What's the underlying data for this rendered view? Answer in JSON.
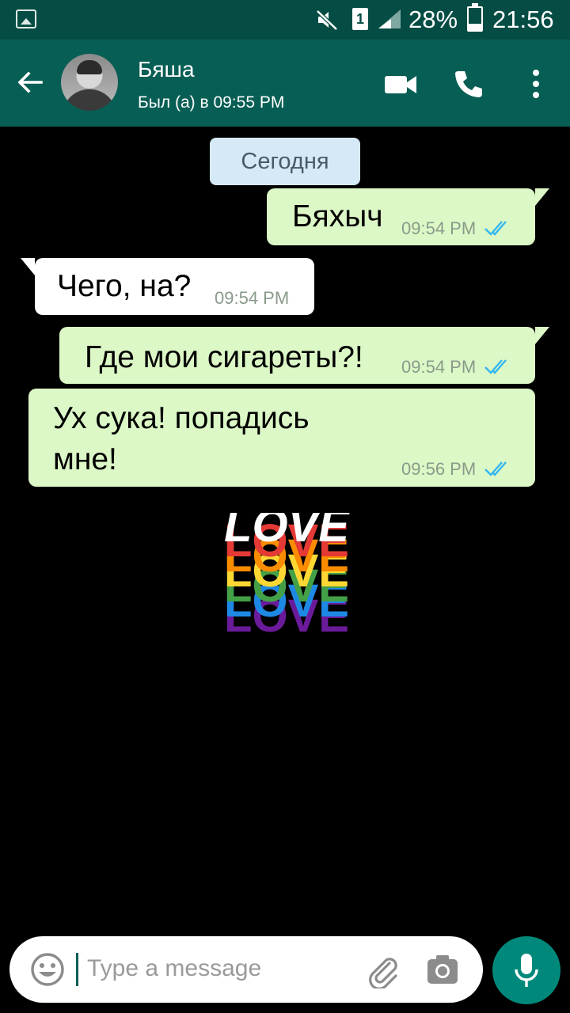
{
  "status_bar": {
    "battery_percent": "28%",
    "time": "21:56",
    "sim_label": "1"
  },
  "header": {
    "contact_name": "Бяша",
    "last_seen": "Был (а) в 09:55 PM"
  },
  "chat": {
    "date_chip": "Сегодня",
    "messages": [
      {
        "direction": "outgoing",
        "text": "Бяхыч",
        "time": "09:54 PM",
        "read": true
      },
      {
        "direction": "incoming",
        "text": "Чего, на?",
        "time": "09:54 PM"
      },
      {
        "direction": "outgoing",
        "text": "Где мои сигареты?!",
        "time": "09:54 PM",
        "read": true
      },
      {
        "direction": "outgoing",
        "text_line1": "Ух сука! попадись",
        "text_line2": "мне!",
        "time": "09:56 PM",
        "read": true
      }
    ],
    "sticker": {
      "text": "LOVE",
      "colors": [
        "#e53935",
        "#fb8c00",
        "#fdd835",
        "#43a047",
        "#1e88e5",
        "#6a1b9a"
      ]
    }
  },
  "input": {
    "placeholder": "Type a message"
  },
  "colors": {
    "header": "#075e54",
    "status_bar": "#054d44",
    "outgoing_bubble": "#dcf8c6",
    "incoming_bubble": "#ffffff",
    "read_ticks": "#34b7f1",
    "mic_button": "#00897b"
  },
  "icons": [
    "gallery-icon",
    "mute-icon",
    "signal-icon",
    "battery-icon",
    "back-arrow-icon",
    "video-call-icon",
    "phone-icon",
    "more-vert-icon",
    "emoji-icon",
    "attach-icon",
    "camera-icon",
    "mic-icon",
    "double-check-icon"
  ]
}
